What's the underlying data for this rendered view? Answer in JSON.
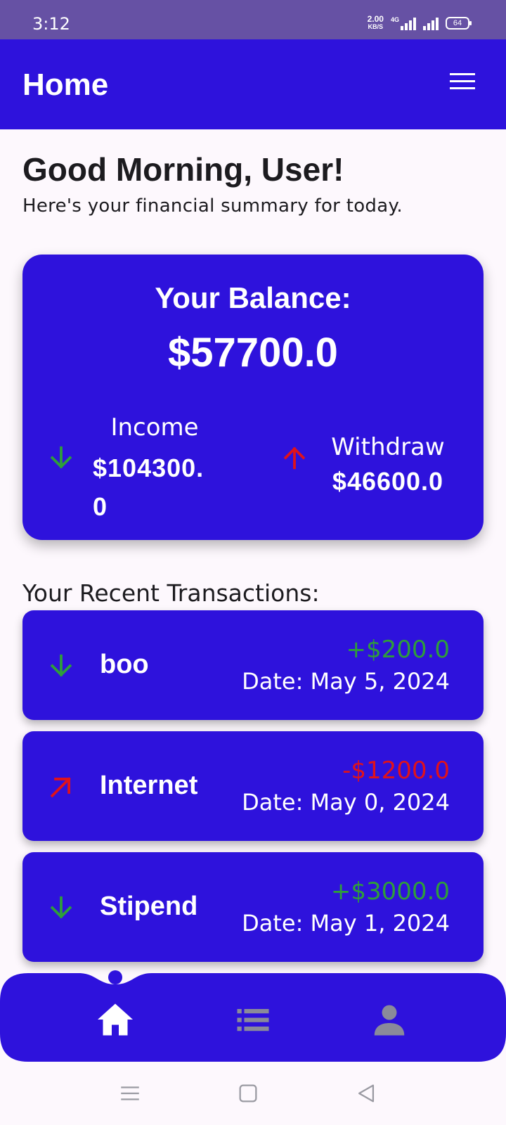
{
  "status_bar": {
    "time": "3:12",
    "net_speed_value": "2.00",
    "net_speed_unit": "KB/S",
    "network_type": "4G",
    "battery": "64"
  },
  "app_bar": {
    "title": "Home",
    "menu_icon": "hamburger-menu-icon"
  },
  "greeting": {
    "title": "Good Morning, User!",
    "subtitle": "Here's your financial summary for today."
  },
  "balance": {
    "label": "Your Balance:",
    "value": "$57700.0",
    "income_label": "Income",
    "income_value": "$104300.0",
    "withdraw_label": "Withdraw",
    "withdraw_value": "$46600.0"
  },
  "recent": {
    "title": "Your Recent Transactions:",
    "transactions": [
      {
        "title": "boo",
        "amount": "+$200.0",
        "date": "Date: May 5, 2024",
        "type": "income",
        "icon": "arrow-down-icon"
      },
      {
        "title": "Internet",
        "amount": "-$1200.0",
        "date": "Date: May 0, 2024",
        "type": "expense",
        "icon": "arrow-up-right-icon"
      },
      {
        "title": "Stipend",
        "amount": "+$3000.0",
        "date": "Date: May 1, 2024",
        "type": "income",
        "icon": "arrow-down-icon"
      }
    ]
  },
  "bottom_nav": {
    "items": [
      {
        "icon": "home-icon",
        "active": true
      },
      {
        "icon": "list-icon",
        "active": false
      },
      {
        "icon": "person-icon",
        "active": false
      }
    ]
  },
  "colors": {
    "primary": "#2e12dc",
    "status_bar": "#6651a4",
    "income": "#2e9e3a",
    "expense": "#e0121b",
    "inactive_icon": "#8a8a9a",
    "background": "#fdf8fd"
  }
}
